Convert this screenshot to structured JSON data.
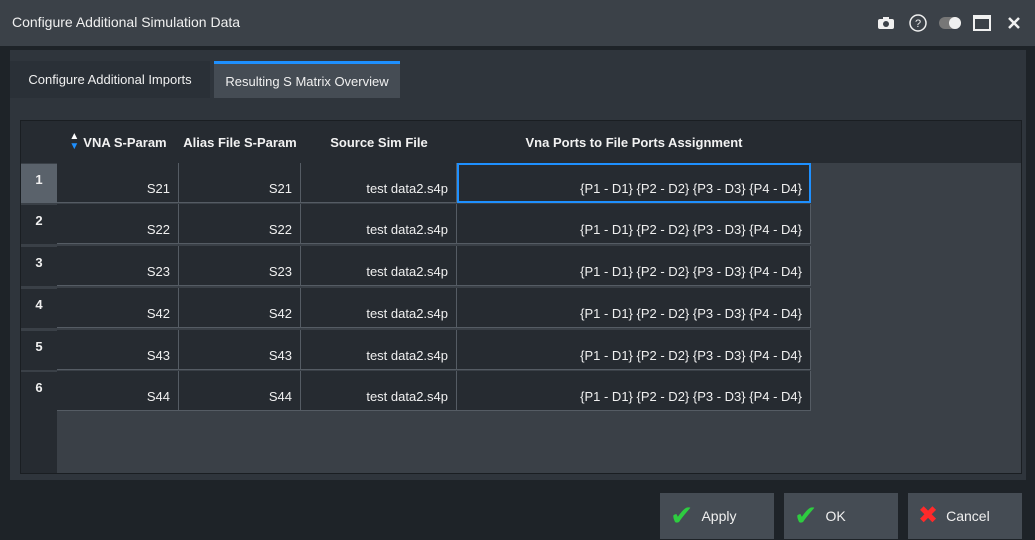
{
  "window": {
    "title": "Configure Additional Simulation Data",
    "icons": [
      "camera-icon",
      "help-icon",
      "toggle-icon",
      "maximize-icon",
      "close-icon"
    ],
    "icon_glyphs": [
      "◙",
      "?",
      "●",
      "▭",
      "✕"
    ]
  },
  "tabs": [
    {
      "label": "Configure Additional Imports",
      "active": false
    },
    {
      "label": "Resulting S Matrix Overview",
      "active": true
    }
  ],
  "table": {
    "columns": [
      "VNA S-Param",
      "Alias File S-Param",
      "Source Sim File",
      "Vna Ports to File Ports Assignment"
    ],
    "rows": [
      {
        "index": "1",
        "vna": "S21",
        "alias": "S21",
        "file": "test data2.s4p",
        "assign": "{P1 - D1} {P2 - D2} {P3 - D3} {P4 - D4}"
      },
      {
        "index": "2",
        "vna": "S22",
        "alias": "S22",
        "file": "test data2.s4p",
        "assign": "{P1 - D1} {P2 - D2} {P3 - D3} {P4 - D4}"
      },
      {
        "index": "3",
        "vna": "S23",
        "alias": "S23",
        "file": "test data2.s4p",
        "assign": "{P1 - D1} {P2 - D2} {P3 - D3} {P4 - D4}"
      },
      {
        "index": "4",
        "vna": "S42",
        "alias": "S42",
        "file": "test data2.s4p",
        "assign": "{P1 - D1} {P2 - D2} {P3 - D3} {P4 - D4}"
      },
      {
        "index": "5",
        "vna": "S43",
        "alias": "S43",
        "file": "test data2.s4p",
        "assign": "{P1 - D1} {P2 - D2} {P3 - D3} {P4 - D4}"
      },
      {
        "index": "6",
        "vna": "S44",
        "alias": "S44",
        "file": "test data2.s4p",
        "assign": "{P1 - D1} {P2 - D2} {P3 - D3} {P4 - D4}"
      }
    ]
  },
  "buttons": {
    "apply": "Apply",
    "ok": "OK",
    "cancel": "Cancel"
  },
  "colors": {
    "accent": "#1e90ff",
    "check": "#2ecc40",
    "cancel_x": "#ff2a2a"
  }
}
